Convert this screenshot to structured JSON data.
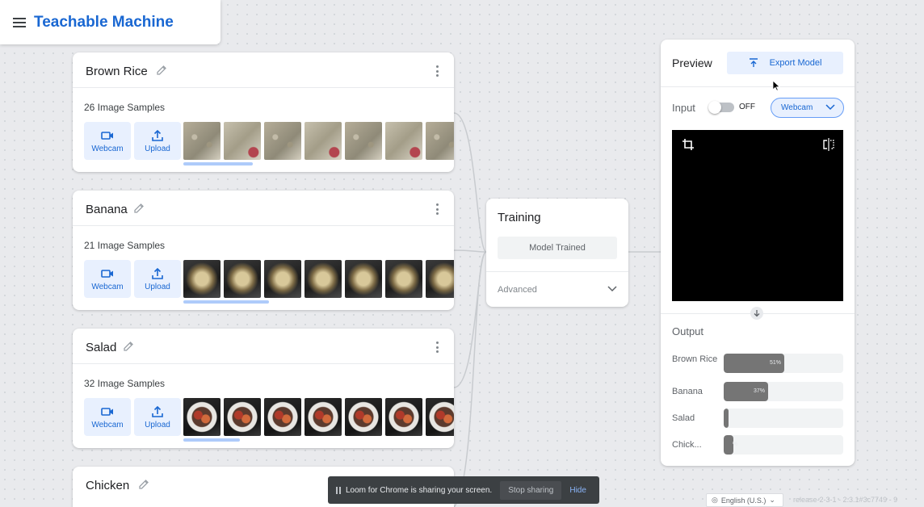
{
  "header": {
    "title": "Teachable Machine"
  },
  "classes": [
    {
      "name": "Brown Rice",
      "samples": "26 Image Samples",
      "webcam_label": "Webcam",
      "upload_label": "Upload"
    },
    {
      "name": "Banana",
      "samples": "21 Image Samples",
      "webcam_label": "Webcam",
      "upload_label": "Upload"
    },
    {
      "name": "Salad",
      "samples": "32 Image Samples",
      "webcam_label": "Webcam",
      "upload_label": "Upload"
    },
    {
      "name": "Chicken"
    }
  ],
  "training": {
    "title": "Training",
    "button_label": "Model Trained",
    "advanced_label": "Advanced"
  },
  "preview": {
    "title": "Preview",
    "export_label": "Export Model",
    "input_label": "Input",
    "toggle_state": "OFF",
    "source_select": "Webcam",
    "output_label": "Output",
    "outputs": [
      {
        "name": "Brown Rice",
        "pct_label": "51%",
        "value": 0.51
      },
      {
        "name": "Banana",
        "pct_label": "37%",
        "value": 0.37
      },
      {
        "name": "Salad",
        "pct_label": "",
        "value": 0.03
      },
      {
        "name": "Chick...",
        "pct_label": "%",
        "value": 0.08
      }
    ]
  },
  "loom": {
    "message": "Loom for Chrome is sharing your screen.",
    "stop_label": "Stop sharing",
    "hide_label": "Hide"
  },
  "footer": {
    "language": "English (U.S.)",
    "release": "release-2-3-1 - 2.3.1#3c7749 - 9"
  },
  "colors": {
    "accent": "#1967d2",
    "accent_light": "#e8f0fe",
    "bar_fill": "#757575"
  }
}
